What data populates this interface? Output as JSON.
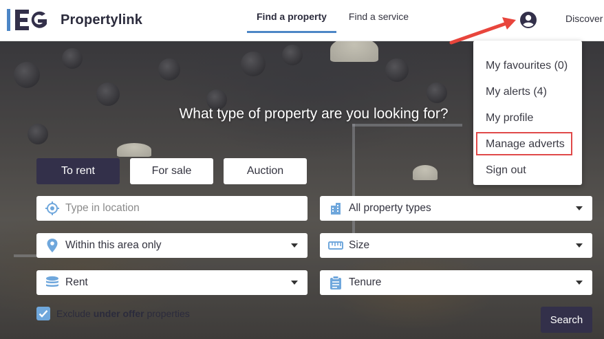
{
  "header": {
    "logo_text": "Propertylink",
    "nav": [
      {
        "label": "Find a property",
        "active": true
      },
      {
        "label": "Find a service",
        "active": false
      }
    ],
    "discover_label": "Discover",
    "account_icon": "user-circle-icon"
  },
  "hero": {
    "title": "What type of property are you looking for?",
    "tabs": [
      {
        "label": "To rent",
        "active": true
      },
      {
        "label": "For sale",
        "active": false
      },
      {
        "label": "Auction",
        "active": false
      }
    ],
    "location": {
      "placeholder": "Type in location",
      "icon": "target-icon"
    },
    "property_types": {
      "value": "All property types",
      "icon": "building-icon"
    },
    "area": {
      "value": "Within this area only",
      "icon": "map-pin-icon"
    },
    "size": {
      "value": "Size",
      "icon": "ruler-icon"
    },
    "price": {
      "value": "Rent",
      "icon": "coins-icon"
    },
    "tenure": {
      "value": "Tenure",
      "icon": "clipboard-icon"
    },
    "exclude": {
      "prefix": "Exclude ",
      "bold": "under offer",
      "suffix": " properties",
      "checked": true
    },
    "search_label": "Search"
  },
  "dropdown": {
    "items": [
      {
        "label": "My favourites (0)"
      },
      {
        "label": "My alerts (4)"
      },
      {
        "label": "My profile"
      },
      {
        "label": "Manage adverts",
        "highlighted": true
      },
      {
        "label": "Sign out"
      }
    ]
  },
  "colors": {
    "accent": "#4c86c6",
    "primary_button": "#33304a",
    "highlight_border": "#e04848",
    "arrow": "#e8453c",
    "checkbox": "#6fa7dc"
  }
}
